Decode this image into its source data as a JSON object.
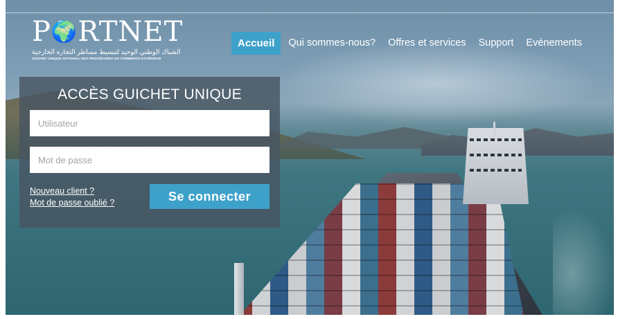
{
  "logo": {
    "wordmark_left": "P",
    "wordmark_right": "RTNET",
    "globe_glyph": "🌍",
    "arabic_tagline": "الشباك الوطني الوحيد لتبسيط مساطر التجارة الخارجية",
    "subtitle": "GUICHET UNIQUE NATIONAL DES PROCÉDURES DU COMMERCE EXTÉRIEUR"
  },
  "nav": {
    "items": [
      {
        "label": "Accueil",
        "active": true
      },
      {
        "label": "Qui sommes-nous?",
        "active": false
      },
      {
        "label": "Offres et services",
        "active": false
      },
      {
        "label": "Support",
        "active": false
      },
      {
        "label": "Evénements",
        "active": false
      }
    ]
  },
  "login": {
    "title": "ACCÈS GUICHET UNIQUE",
    "username_placeholder": "Utilisateur",
    "password_placeholder": "Mot de passe",
    "new_client_link": "Nouveau client ?",
    "forgot_password_link": "Mot de passe oublié ?",
    "submit_label": "Se connecter"
  },
  "colors": {
    "accent": "#3ea1c9",
    "panel": "#485662"
  },
  "icons": {
    "logo_globe": "globe-icon"
  }
}
